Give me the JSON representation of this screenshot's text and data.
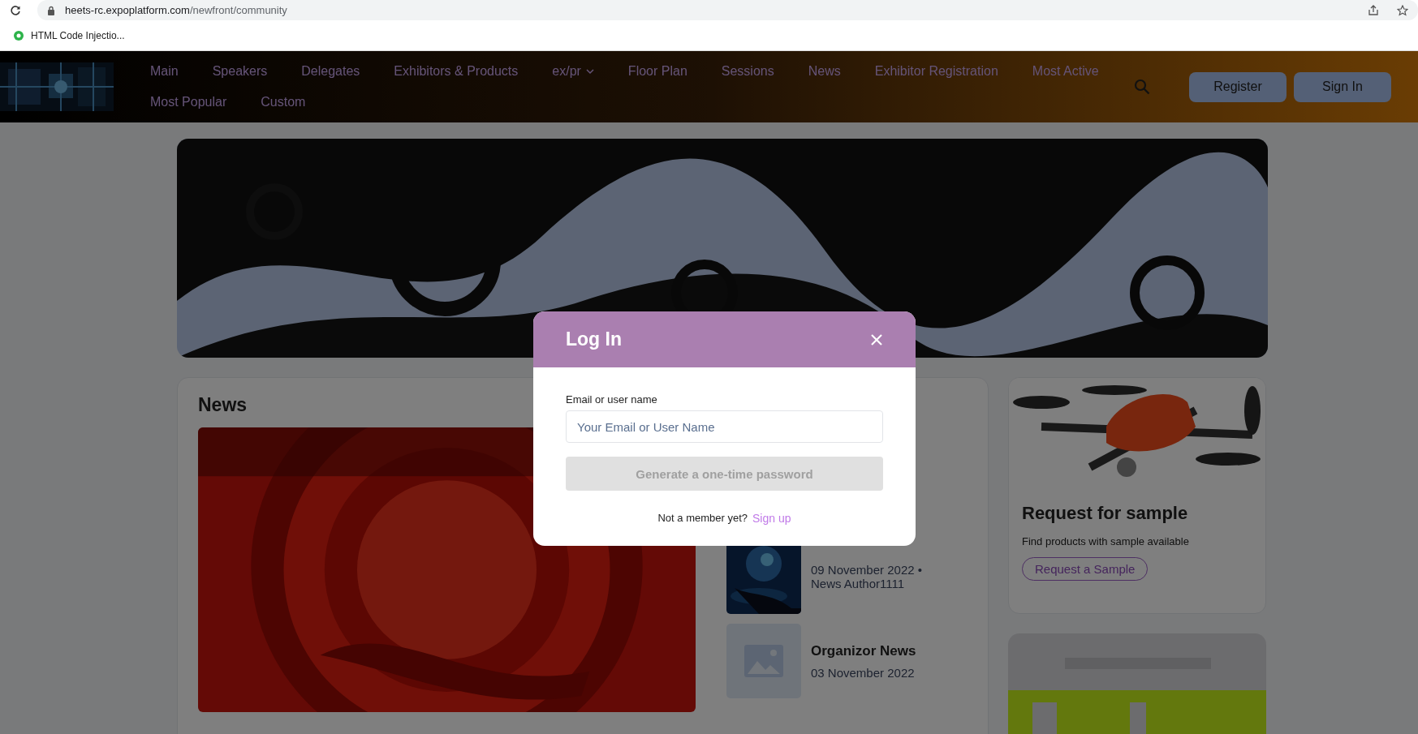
{
  "browser": {
    "url_host": "heets-rc.expoplatform.com",
    "url_path": "/newfront/community",
    "bookmark": "HTML Code Injectio..."
  },
  "nav": {
    "items": [
      {
        "label": "Main",
        "kind": "link"
      },
      {
        "label": "Speakers",
        "kind": "link"
      },
      {
        "label": "Delegates",
        "kind": "link"
      },
      {
        "label": "Exhibitors & Products",
        "kind": "link"
      },
      {
        "label": "ex/pr",
        "kind": "dropdown"
      },
      {
        "label": "Floor Plan",
        "kind": "link"
      },
      {
        "label": "Sessions",
        "kind": "link"
      },
      {
        "label": "News",
        "kind": "link"
      },
      {
        "label": "Exhibitor Registration",
        "kind": "link"
      },
      {
        "label": "Most Active",
        "kind": "link"
      },
      {
        "label": "Most Popular",
        "kind": "link"
      },
      {
        "label": "Custom",
        "kind": "link"
      }
    ],
    "buttons": [
      "Register",
      "Sign In"
    ]
  },
  "news": {
    "title": "News",
    "items": [
      {
        "date": "09 November 2022 •",
        "author": "News Author1111",
        "kind": "picture"
      },
      {
        "title": "Organizor News",
        "date": "03 November 2022",
        "kind": "placeholder"
      }
    ]
  },
  "sample_card": {
    "title": "Request for sample",
    "text": "Find products with sample available",
    "button": "Request a Sample"
  },
  "modal": {
    "title": "Log In",
    "field_label": "Email or user name",
    "placeholder": "Your Email or User Name",
    "button": "Generate a one-time password",
    "button_disabled": true,
    "footer_text": "Not a member yet?",
    "footer_link": "Sign up"
  }
}
